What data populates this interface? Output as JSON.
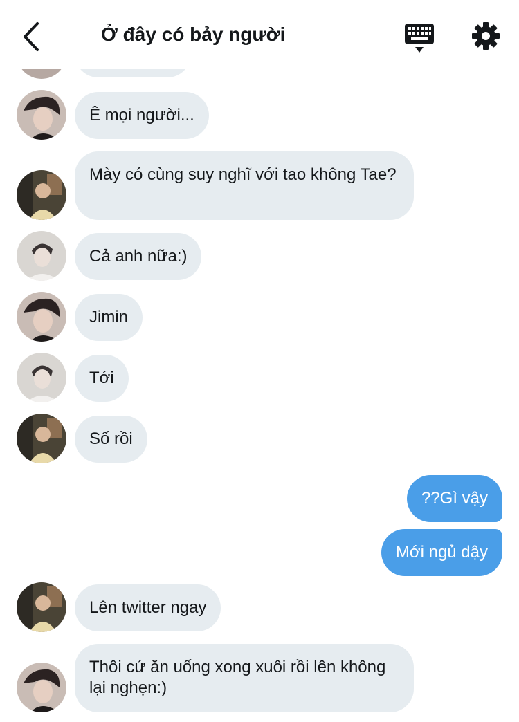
{
  "header": {
    "title": "Ở đây có bảy người",
    "back_icon": "chevron-left-icon",
    "keyboard_icon": "keyboard-icon",
    "settings_icon": "gear-icon"
  },
  "colors": {
    "incoming_bubble": "#e6ecf0",
    "outgoing_bubble": "#4a9ee8",
    "text": "#14171a"
  },
  "messages": [
    {
      "from": "avatar-a",
      "text": "Ê mọi người..."
    },
    {
      "from": "avatar-b",
      "text": "Mày có cùng suy nghĩ với tao không Tae?"
    },
    {
      "from": "avatar-c",
      "text": "Cả anh nữa:)"
    },
    {
      "from": "avatar-a",
      "text": "Jimin"
    },
    {
      "from": "avatar-c",
      "text": "Tới"
    },
    {
      "from": "avatar-b",
      "text": "Số rồi"
    },
    {
      "from": "me",
      "text": "??Gì vậy"
    },
    {
      "from": "me",
      "text": "Mới ngủ dậy"
    },
    {
      "from": "avatar-b",
      "text": "Lên twitter ngay"
    },
    {
      "from": "avatar-a",
      "text": "Thôi cứ ăn uống xong xuôi rồi lên không lại nghẹn:)"
    }
  ]
}
